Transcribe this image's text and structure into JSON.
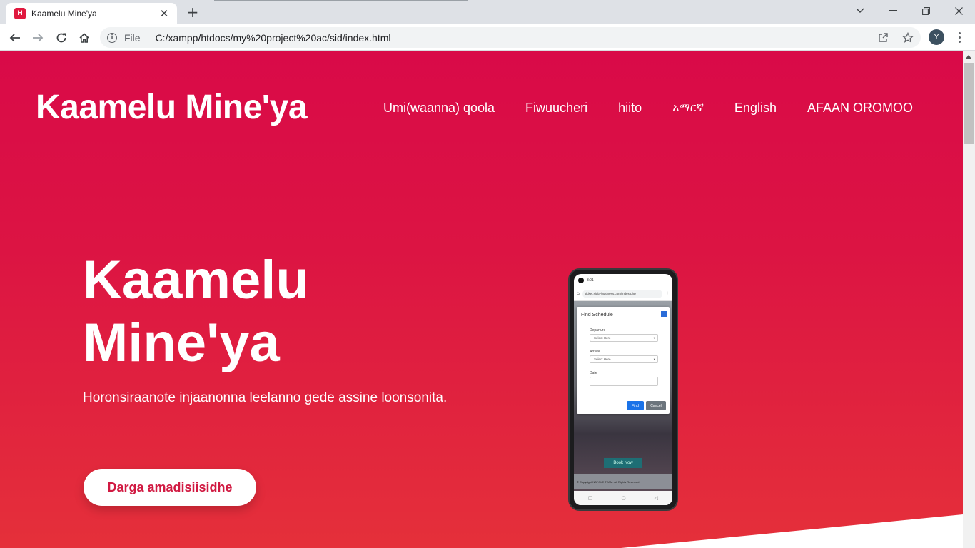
{
  "browser": {
    "tab": {
      "favicon_letter": "H",
      "title": "Kaamelu Mine'ya",
      "close_glyph": "✕"
    },
    "new_tab_glyph": "+",
    "omnibox": {
      "scheme_label": "File",
      "url": "C:/xampp/htdocs/my%20project%20ac/sid/index.html"
    },
    "profile_initial": "Y"
  },
  "site": {
    "brand": "Kaamelu Mine'ya",
    "nav": [
      {
        "label": "Umi(waanna) qoola"
      },
      {
        "label": "Fiwuucheri"
      },
      {
        "label": "hiito"
      },
      {
        "label": "አማርኛ"
      },
      {
        "label": "English"
      },
      {
        "label": "AFAAN OROMOO"
      }
    ],
    "hero": {
      "title": "Kaamelu Mine'ya",
      "subtitle": "Horonsiraanote injaanonna leelanno gede assine loonsonita.",
      "cta_label": "Darga amadisiisidhe"
    },
    "colors": {
      "accent": "#d90a48",
      "accent_bottom": "#e5303a",
      "cta_text": "#d11a42"
    }
  },
  "phone_mockup": {
    "status_time": "3:01",
    "url": "ticket.sidia-business.com/index.php",
    "modal_title": "Find Schedule",
    "departure_label": "Departure",
    "departure_placeholder": "Select Here",
    "arrival_label": "Arrival",
    "arrival_placeholder": "Select Here",
    "date_label": "Date",
    "find_label": "Find",
    "cancel_label": "Cancel",
    "book_label": "Book Now",
    "footer_text": "© Copyright NAYOLE TEAM. All Rights Reserved"
  }
}
